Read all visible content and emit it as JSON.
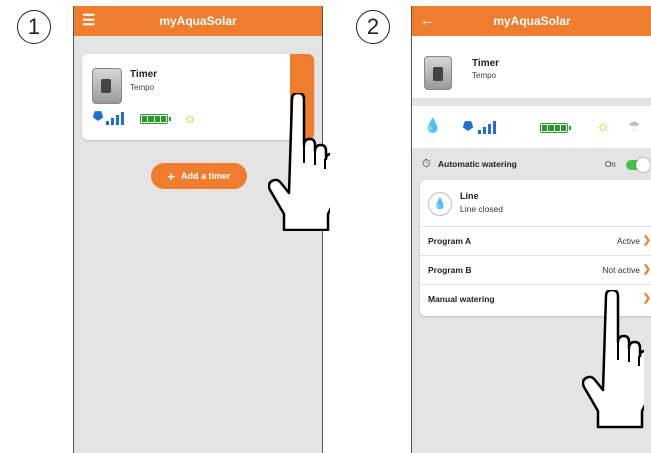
{
  "steps": [
    "1",
    "2"
  ],
  "colors": {
    "accent": "#ef7d2d",
    "status_blue": "#1d6fd1",
    "battery_green": "#2a9a2a",
    "toggle_green": "#4cc04c"
  },
  "screen1": {
    "app_title": "myAquaSolar",
    "menu_icon": "menu-icon",
    "device": {
      "name": "Timer",
      "model": "Tempo"
    },
    "add_button_label": "Add a timer"
  },
  "screen2": {
    "app_title": "myAquaSolar",
    "back_icon": "back-arrow-icon",
    "device": {
      "name": "Timer",
      "model": "Tempo"
    },
    "auto_watering": {
      "label": "Automatic watering",
      "state": "On"
    },
    "line": {
      "name": "Line",
      "status": "Line closed"
    },
    "rows": [
      {
        "label": "Program A",
        "value": "Active"
      },
      {
        "label": "Program B",
        "value": "Not active"
      },
      {
        "label": "Manual watering",
        "value": ""
      }
    ]
  }
}
